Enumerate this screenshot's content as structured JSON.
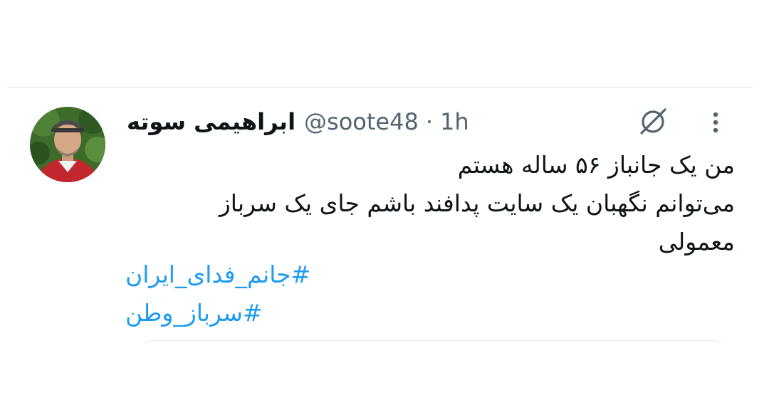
{
  "tweet": {
    "author": {
      "display_name": "ابراهیمی سوته",
      "handle": "@soote48",
      "avatar_icon": "user-avatar-photo"
    },
    "separator": "·",
    "timestamp": "1h",
    "icons": {
      "grok": "grok-icon",
      "more": "more-vertical-icon"
    },
    "text_lines": [
      "من یک جانباز ۵۶ ساله هستم",
      "می‌توانم نگهبان یک سایت پدافند باشم جای یک سرباز",
      "معمولی"
    ],
    "hashtags": [
      "#جانم_فدای_ایران",
      "#سرباز_وطن"
    ]
  },
  "colors": {
    "text": "#0f1419",
    "secondary": "#536471",
    "link": "#1d9bf0",
    "divider": "#e6e8ea"
  }
}
